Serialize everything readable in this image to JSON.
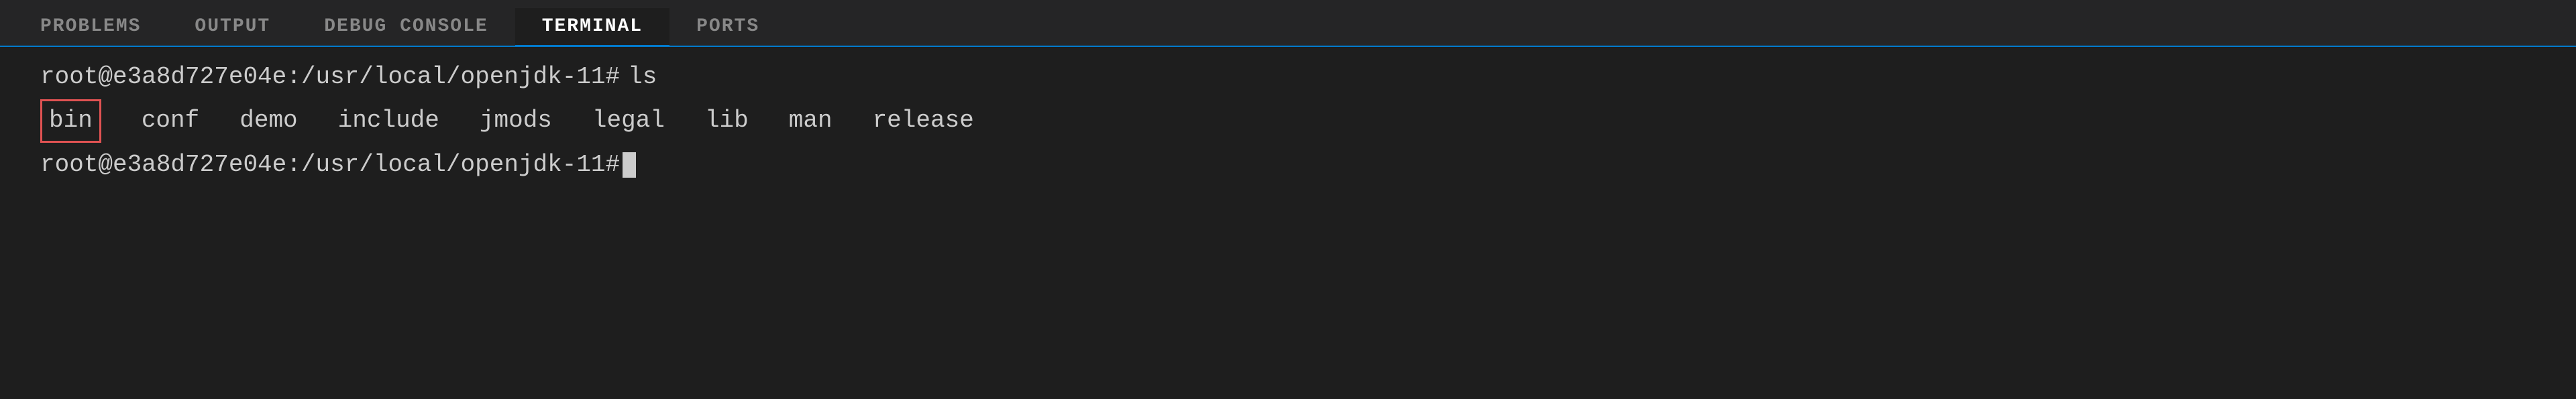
{
  "tabs": [
    {
      "id": "problems",
      "label": "PROBLEMS",
      "active": false
    },
    {
      "id": "output",
      "label": "OUTPUT",
      "active": false
    },
    {
      "id": "debug-console",
      "label": "DEBUG CONSOLE",
      "active": false
    },
    {
      "id": "terminal",
      "label": "TERMINAL",
      "active": true
    },
    {
      "id": "ports",
      "label": "PORTS",
      "active": false
    }
  ],
  "terminal": {
    "lines": [
      {
        "id": "line1",
        "prompt": "root@e3a8d727e04e:/usr/local/openjdk-11#",
        "command": "ls"
      },
      {
        "id": "line2",
        "items": [
          "bin",
          "conf",
          "demo",
          "include",
          "jmods",
          "legal",
          "lib",
          "man",
          "release"
        ]
      },
      {
        "id": "line3",
        "prompt": "root@e3a8d727e04e:/usr/local/openjdk-11#",
        "command": ""
      }
    ],
    "highlighted_item": "bin"
  }
}
